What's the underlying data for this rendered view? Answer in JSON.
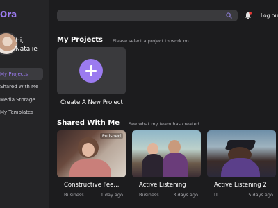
{
  "app": {
    "logo": "Ora"
  },
  "user": {
    "greeting": "Hi,",
    "name": "Natalie"
  },
  "sidebar": {
    "items": [
      {
        "label": "My Projects",
        "active": true
      },
      {
        "label": "Shared With Me"
      },
      {
        "label": "Media Storage"
      },
      {
        "label": "My Templates"
      }
    ]
  },
  "header": {
    "search_placeholder": "",
    "logout_label": "Log out"
  },
  "my_projects": {
    "title": "My Projects",
    "subtitle": "Please select a project to work on",
    "new_label": "Create A New Project"
  },
  "shared": {
    "title": "Shared With Me",
    "subtitle": "See what my team has created",
    "cards": [
      {
        "title": "Constructive Fee...",
        "badge": "Pulished",
        "category": "Business",
        "time": "1 day ago"
      },
      {
        "title": "Active Listening",
        "category": "Business",
        "time": "3 days ago"
      },
      {
        "title": "Active Listening 2",
        "category": "IT",
        "time": "5 days ago"
      }
    ]
  },
  "colors": {
    "accent": "#9b7bf0",
    "bg": "#1c1c1e",
    "panel": "#3a3a3d",
    "notify": "#e53935"
  }
}
